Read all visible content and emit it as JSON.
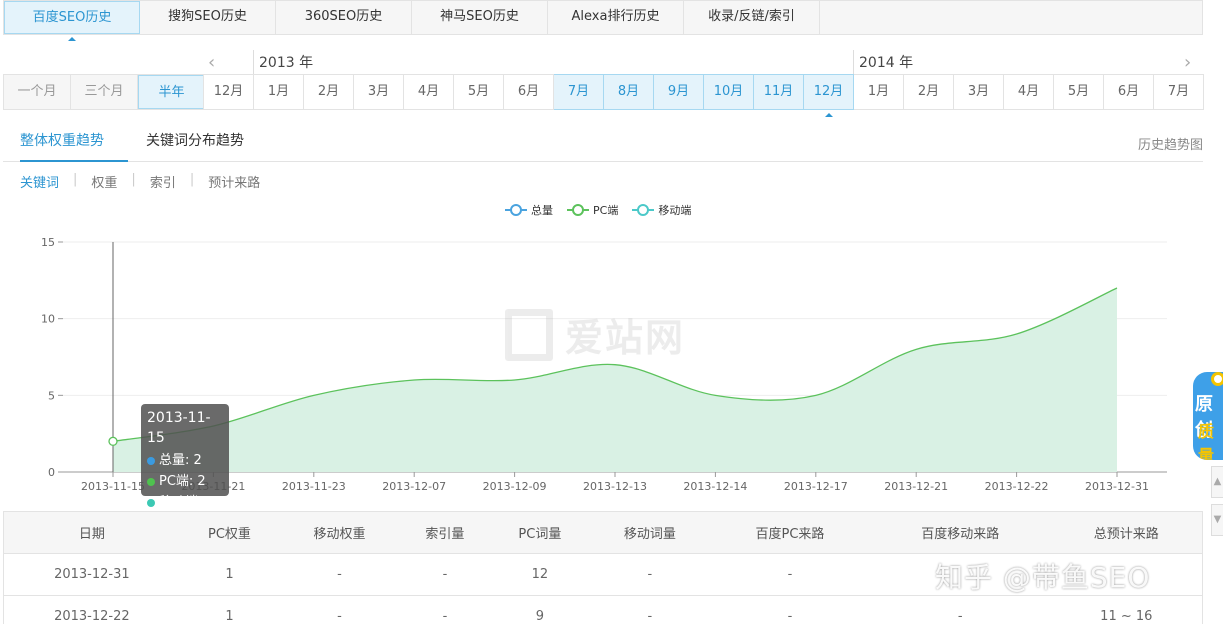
{
  "top_tabs": [
    {
      "label": "百度SEO历史",
      "active": true
    },
    {
      "label": "搜狗SEO历史"
    },
    {
      "label": "360SEO历史"
    },
    {
      "label": "神马SEO历史"
    },
    {
      "label": "Alexa排行历史"
    },
    {
      "label": "收录/反链/索引"
    }
  ],
  "range_buttons": [
    {
      "label": "一个月"
    },
    {
      "label": "三个月"
    },
    {
      "label": "半年",
      "active": true
    }
  ],
  "years": {
    "left": "2013 年",
    "right": "2014 年"
  },
  "months": [
    {
      "label": "12月"
    },
    {
      "label": "1月"
    },
    {
      "label": "2月"
    },
    {
      "label": "3月"
    },
    {
      "label": "4月"
    },
    {
      "label": "5月"
    },
    {
      "label": "6月"
    },
    {
      "label": "7月",
      "selected": true
    },
    {
      "label": "8月",
      "selected": true
    },
    {
      "label": "9月",
      "selected": true
    },
    {
      "label": "10月",
      "selected": true
    },
    {
      "label": "11月",
      "selected": true
    },
    {
      "label": "12月",
      "selected": true,
      "current": true
    },
    {
      "label": "1月"
    },
    {
      "label": "2月"
    },
    {
      "label": "3月"
    },
    {
      "label": "4月"
    },
    {
      "label": "5月"
    },
    {
      "label": "6月"
    },
    {
      "label": "7月"
    }
  ],
  "sub_tabs": [
    {
      "label": "整体权重趋势",
      "active": true
    },
    {
      "label": "关键词分布趋势"
    }
  ],
  "history_link": "历史趋势图",
  "filters": [
    {
      "label": "关键词",
      "active": true
    },
    {
      "label": "权重"
    },
    {
      "label": "索引"
    },
    {
      "label": "预计来路"
    }
  ],
  "legend": [
    {
      "label": "总量",
      "color": "#4aa3df"
    },
    {
      "label": "PC端",
      "color": "#5cc25c"
    },
    {
      "label": "移动端",
      "color": "#4cc9c9"
    }
  ],
  "watermark": "爱站网",
  "chart_data": {
    "type": "area",
    "categories": [
      "2013-11-15",
      "2013-11-21",
      "2013-11-23",
      "2013-12-07",
      "2013-12-09",
      "2013-12-13",
      "2013-12-14",
      "2013-12-17",
      "2013-12-21",
      "2013-12-22",
      "2013-12-31"
    ],
    "series": [
      {
        "name": "PC端",
        "values": [
          2,
          3,
          5,
          6,
          6,
          7,
          5,
          5,
          8,
          9,
          12
        ],
        "color": "#5cc25c",
        "fill": "#d9f1e4"
      }
    ],
    "ylim": [
      0,
      15
    ],
    "yticks": [
      0,
      5,
      10,
      15
    ],
    "grid": true
  },
  "tooltip": {
    "date": "2013-11-15",
    "rows": [
      {
        "label": "总量: 2",
        "color": "#3a9be0"
      },
      {
        "label": "PC端: 2",
        "color": "#4fc24f"
      },
      {
        "label": "移动端: -",
        "color": "#3cc9b4"
      }
    ]
  },
  "table": {
    "headers": [
      "日期",
      "PC权重",
      "移动权重",
      "索引量",
      "PC词量",
      "移动词量",
      "百度PC来路",
      "百度移动来路",
      "总预计来路"
    ],
    "rows": [
      [
        "2013-12-31",
        "1",
        "-",
        "-",
        "12",
        "-",
        "-",
        "",
        ""
      ],
      [
        "2013-12-22",
        "1",
        "-",
        "-",
        "9",
        "-",
        "-",
        "-",
        "11 ~ 16"
      ]
    ]
  },
  "overlay_text": "知乎 @带鱼SEO",
  "side_badge": {
    "line1": "原创",
    "line2": "质量"
  }
}
